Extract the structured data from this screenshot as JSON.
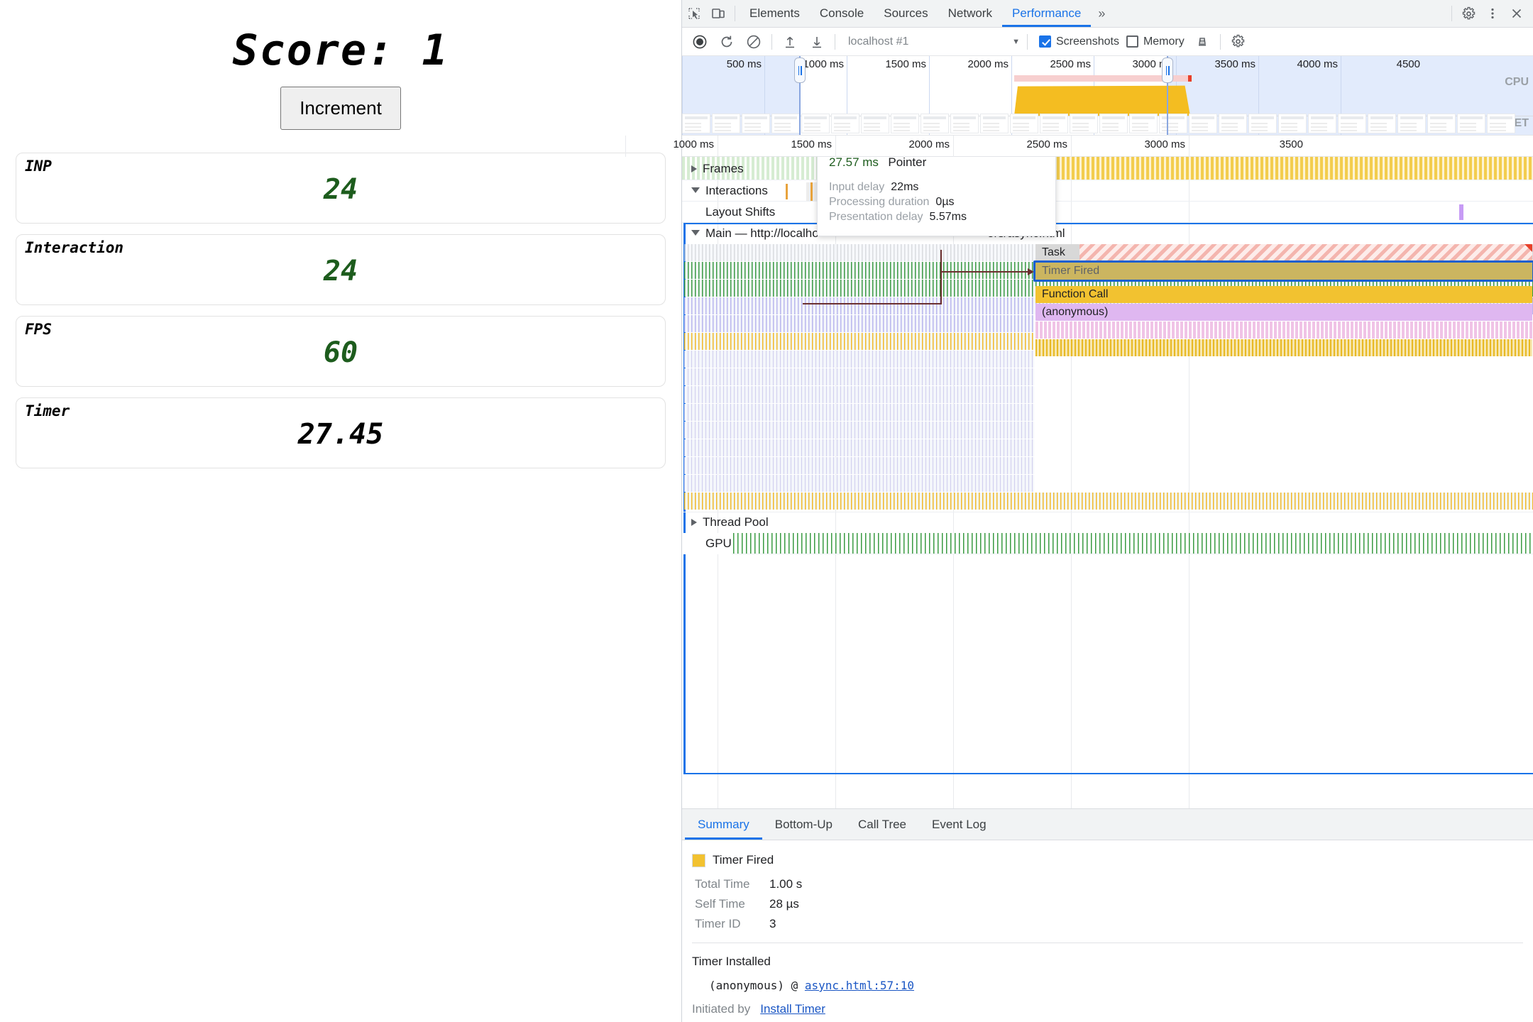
{
  "page": {
    "score_label": "Score: 1",
    "increment_button": "Increment",
    "metrics": [
      {
        "label": "INP",
        "value": "24",
        "tone": "green"
      },
      {
        "label": "Interaction",
        "value": "24",
        "tone": "green"
      },
      {
        "label": "FPS",
        "value": "60",
        "tone": "green"
      },
      {
        "label": "Timer",
        "value": "27.45",
        "tone": "dark"
      }
    ]
  },
  "devtools": {
    "tabs": [
      {
        "label": "Elements",
        "active": false
      },
      {
        "label": "Console",
        "active": false
      },
      {
        "label": "Sources",
        "active": false
      },
      {
        "label": "Network",
        "active": false
      },
      {
        "label": "Performance",
        "active": true
      }
    ],
    "more_tabs_label": "»",
    "icons": {
      "inspect": "inspect-element-icon",
      "device": "device-toolbar-icon",
      "settings": "gear-icon",
      "kebab": "more-options-icon",
      "close": "close-icon"
    },
    "toolbar": {
      "record": "record-icon",
      "reload": "reload-and-record-icon",
      "clear": "clear-icon",
      "load": "load-profile-icon",
      "save": "save-profile-icon",
      "profile_select": "localhost #1",
      "screenshots_label": "Screenshots",
      "screenshots_checked": true,
      "memory_label": "Memory",
      "memory_checked": false,
      "cleanup": "collect-garbage-icon",
      "capture_settings": "capture-settings-gear-icon"
    },
    "overview": {
      "ticks": [
        "500 ms",
        "1000 ms",
        "1500 ms",
        "2000 ms",
        "2500 ms",
        "3000 ms",
        "3500 ms",
        "4000 ms",
        "4500"
      ],
      "cpu_label": "CPU",
      "net_label": "NET"
    },
    "timeline_ruler": [
      "1000 ms",
      "1500 ms",
      "2000 ms",
      "2500 ms",
      "3000 ms",
      "3500"
    ],
    "tracks": [
      {
        "name": "Frames",
        "expanded": false
      },
      {
        "name": "Interactions",
        "expanded": true
      },
      {
        "name": "Layout Shifts",
        "expanded": null
      },
      {
        "name": "Main — http://localho",
        "name_tail": "ers/async.html",
        "expanded": true
      },
      {
        "name": "Thread Pool",
        "expanded": false
      },
      {
        "name": "GPU",
        "expanded": null
      }
    ],
    "flame_bars": [
      {
        "label": "Task",
        "kind": "task"
      },
      {
        "label": "Timer Fired",
        "kind": "timer",
        "selected": true
      },
      {
        "label": "Function Call",
        "kind": "function"
      },
      {
        "label": "(anonymous)",
        "kind": "anonymous"
      }
    ],
    "tooltip": {
      "duration": "27.57 ms",
      "title": "Pointer",
      "rows": [
        {
          "key": "Input delay",
          "value": "22ms"
        },
        {
          "key": "Processing duration",
          "value": "0µs"
        },
        {
          "key": "Presentation delay",
          "value": "5.57ms"
        }
      ]
    },
    "bottom": {
      "tabs": [
        {
          "label": "Summary",
          "active": true
        },
        {
          "label": "Bottom-Up",
          "active": false
        },
        {
          "label": "Call Tree",
          "active": false
        },
        {
          "label": "Event Log",
          "active": false
        }
      ],
      "event_name": "Timer Fired",
      "event_color": "#f2c230",
      "details": [
        {
          "key": "Total Time",
          "value": "1.00 s"
        },
        {
          "key": "Self Time",
          "value": "28 µs"
        },
        {
          "key": "Timer ID",
          "value": "3"
        }
      ],
      "section_title": "Timer Installed",
      "stack_fn": "(anonymous)",
      "stack_at": "@",
      "stack_link": "async.html:57:10",
      "initiated_by_label": "Initiated by",
      "initiated_by_link": "Install Timer"
    }
  },
  "colors": {
    "accent": "#1a73e8",
    "green_metric": "#1d5c1d",
    "timer_yellow": "#f2c230",
    "anon_purple": "#dfb7f0",
    "task_red": "#e8402a"
  }
}
